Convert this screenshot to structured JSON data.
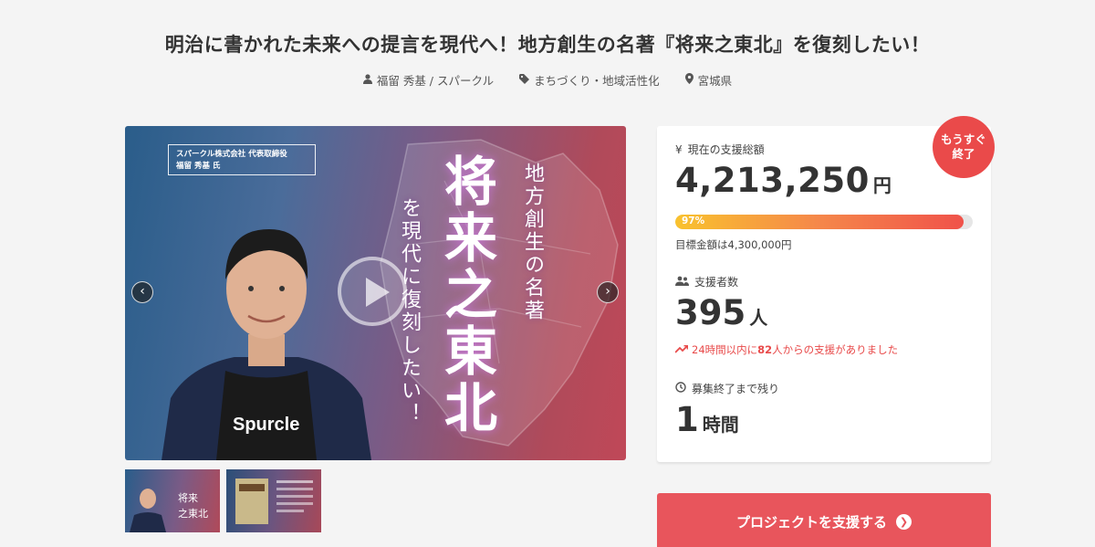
{
  "project": {
    "title": "明治に書かれた未来への提言を現代へ！地方創生の名著『将来之東北』を復刻したい！",
    "owner": "福留 秀基 / スパークル",
    "category": "まちづくり・地域活性化",
    "location": "宮城県"
  },
  "hero": {
    "caption_line1": "スパークル株式会社 代表取締役",
    "caption_line2": "福留 秀基 氏",
    "vertical_line1": "地方創生の名著",
    "vertical_line2": "を現代に復刻したい！",
    "book_title": "将来之東北",
    "shirt_text": "Spurcle"
  },
  "stats": {
    "amount_label": "現在の支援総額",
    "amount_value": "4,213,250",
    "amount_unit": "円",
    "progress_percent": 97,
    "progress_label": "97%",
    "goal_text": "目標金額は4,300,000円",
    "backers_label": "支援者数",
    "backers_value": "395",
    "backers_unit": "人",
    "trend_prefix": "24時間以内に",
    "trend_count": "82",
    "trend_suffix": "人からの支援がありました",
    "time_label": "募集終了まで残り",
    "time_value": "1",
    "time_unit": "時間"
  },
  "badge": {
    "line1": "もうすぐ",
    "line2": "終了"
  },
  "support_button": "プロジェクトを支援する",
  "colors": {
    "accent": "#e8555c",
    "badge": "#ea4a4a",
    "trend": "#e84a4a"
  }
}
